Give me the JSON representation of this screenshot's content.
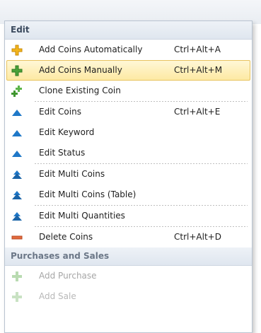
{
  "menu": {
    "sections": [
      {
        "header": "Edit",
        "items": [
          {
            "label": "Add Coins Automatically",
            "shortcut": "Ctrl+Alt+A",
            "icon": "plus-yellow-icon"
          },
          {
            "label": "Add Coins Manually",
            "shortcut": "Ctrl+Alt+M",
            "icon": "plus-green-icon"
          },
          {
            "label": "Clone Existing Coin",
            "shortcut": "",
            "icon": "clone-green-icon"
          },
          {
            "label": "Edit Coins",
            "shortcut": "Ctrl+Alt+E",
            "icon": "blue-triangle-icon"
          },
          {
            "label": "Edit Keyword",
            "shortcut": "",
            "icon": "blue-triangle-icon"
          },
          {
            "label": "Edit Status",
            "shortcut": "",
            "icon": "blue-triangle-icon"
          },
          {
            "label": "Edit Multi Coins",
            "shortcut": "",
            "icon": "blue-double-triangle-icon"
          },
          {
            "label": "Edit Multi Coins (Table)",
            "shortcut": "",
            "icon": "blue-double-triangle-icon"
          },
          {
            "label": "Edit Multi Quantities",
            "shortcut": "",
            "icon": "blue-double-triangle-icon"
          },
          {
            "label": "Delete Coins",
            "shortcut": "Ctrl+Alt+D",
            "icon": "minus-red-icon"
          }
        ]
      },
      {
        "header": "Purchases and Sales",
        "items": [
          {
            "label": "Add Purchase",
            "shortcut": "",
            "icon": "plus-gray-icon"
          },
          {
            "label": "Add Sale",
            "shortcut": "",
            "icon": "plus-gray-icon"
          }
        ]
      }
    ]
  },
  "colors": {
    "highlight": "#fde9a3",
    "highlight_border": "#e8c35f",
    "plus_yellow": "#f2b51c",
    "plus_green": "#4aa23a",
    "edit_blue": "#1f78c8",
    "delete_red": "#e36b3e",
    "disabled_text": "#a6a6a6"
  }
}
